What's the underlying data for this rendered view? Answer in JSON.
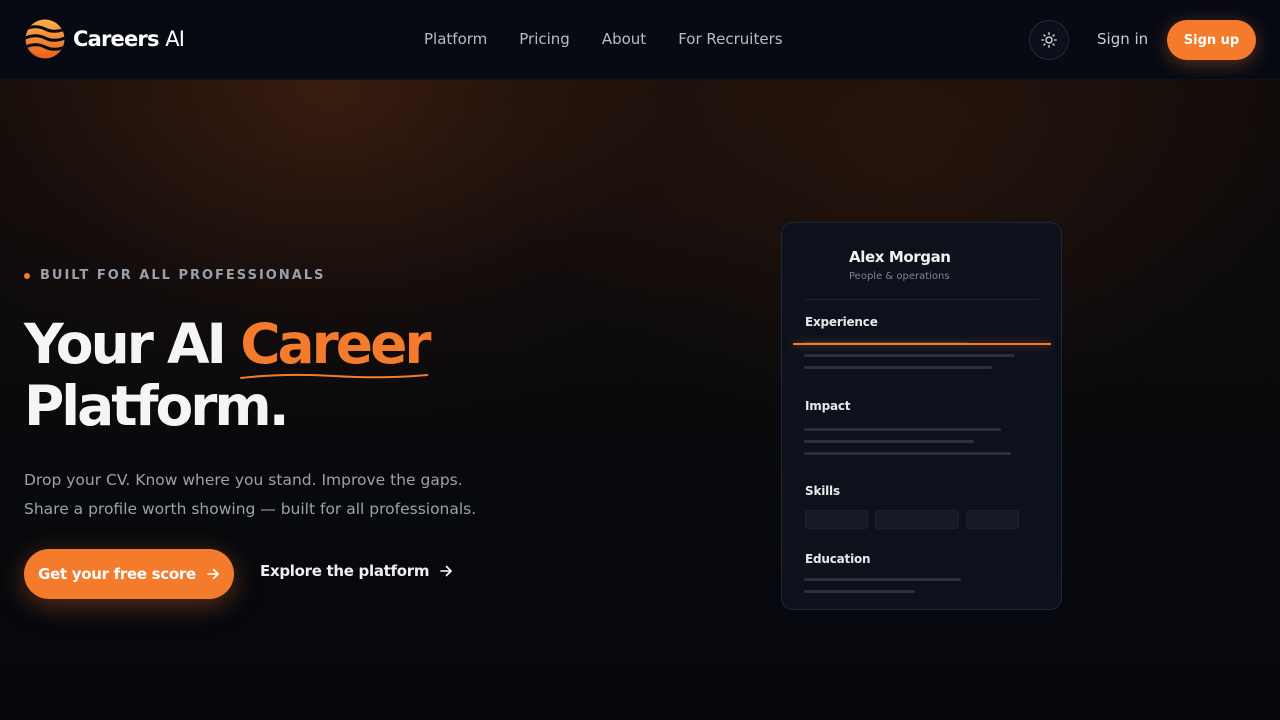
{
  "nav": {
    "brand": "Careers",
    "brand_suffix": "AI",
    "links": [
      "Platform",
      "Pricing",
      "About",
      "For Recruiters"
    ],
    "theme_icon": "sun-icon",
    "sign_in": "Sign in",
    "sign_up": "Sign up"
  },
  "hero": {
    "eyebrow": "BUILT FOR ALL PROFESSIONALS",
    "headline_part1": "Your AI",
    "headline_accent": "Career",
    "headline_part2": "Platform.",
    "subtext_line1": "Drop your CV. Know where you stand. Improve the gaps.",
    "subtext_line2": "Share a profile worth showing — built for all professionals.",
    "cta_primary": "Get your free score",
    "cta_secondary": "Explore the platform"
  },
  "profile_card": {
    "name": "Alex Morgan",
    "role": "People & operations",
    "sections": [
      "Experience",
      "Impact",
      "Skills",
      "Education"
    ]
  },
  "colors": {
    "accent": "#f47a2c",
    "background": "#05080f",
    "nav_background": "#070a13",
    "card_background": "#0d111b"
  }
}
